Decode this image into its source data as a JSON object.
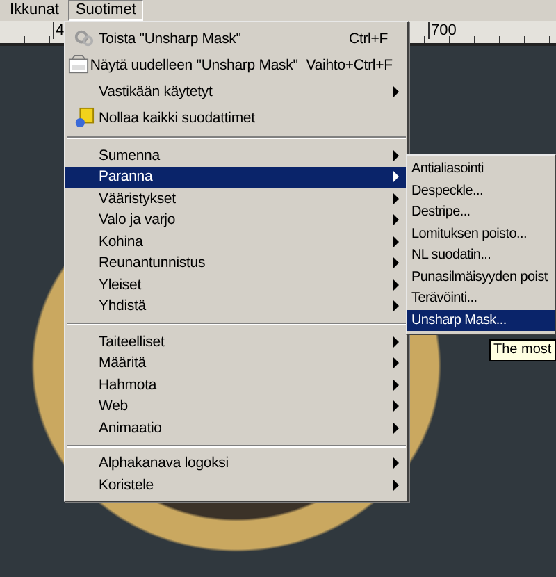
{
  "menubar": [
    {
      "label": "Ikkunat",
      "selected": false
    },
    {
      "label": "Suotimet",
      "selected": true
    }
  ],
  "ruler": {
    "labels": [
      "4",
      "700"
    ]
  },
  "menu": {
    "sections": [
      {
        "items": [
          {
            "label": "Toista \"Unsharp Mask\"",
            "shortcut": "Ctrl+F",
            "submenu": false,
            "selected": false
          },
          {
            "label": "Näytä uudelleen \"Unsharp Mask\"",
            "shortcut": "Vaihto+Ctrl+F",
            "submenu": false,
            "selected": false
          },
          {
            "label": "Vastikään käytetyt",
            "submenu": true,
            "selected": false
          },
          {
            "label": "Nollaa kaikki suodattimet",
            "submenu": false,
            "selected": false
          }
        ]
      },
      {
        "items": [
          {
            "label": "Sumenna",
            "submenu": true,
            "selected": false
          },
          {
            "label": "Paranna",
            "submenu": true,
            "selected": true
          },
          {
            "label": "Vääristykset",
            "submenu": true,
            "selected": false
          },
          {
            "label": "Valo ja varjo",
            "submenu": true,
            "selected": false
          },
          {
            "label": "Kohina",
            "submenu": true,
            "selected": false
          },
          {
            "label": "Reunantunnistus",
            "submenu": true,
            "selected": false
          },
          {
            "label": "Yleiset",
            "submenu": true,
            "selected": false
          },
          {
            "label": "Yhdistä",
            "submenu": true,
            "selected": false
          }
        ]
      },
      {
        "items": [
          {
            "label": "Taiteelliset",
            "submenu": true,
            "selected": false
          },
          {
            "label": "Määritä",
            "submenu": true,
            "selected": false
          },
          {
            "label": "Hahmota",
            "submenu": true,
            "selected": false
          },
          {
            "label": "Web",
            "submenu": true,
            "selected": false
          },
          {
            "label": "Animaatio",
            "submenu": true,
            "selected": false
          }
        ]
      },
      {
        "items": [
          {
            "label": "Alphakanava logoksi",
            "submenu": true,
            "selected": false
          },
          {
            "label": "Koristele",
            "submenu": true,
            "selected": false
          }
        ]
      }
    ]
  },
  "submenu": {
    "items": [
      {
        "label": "Antialiasointi",
        "selected": false
      },
      {
        "label": "Despeckle...",
        "selected": false
      },
      {
        "label": "Destripe...",
        "selected": false
      },
      {
        "label": "Lomituksen poisto...",
        "selected": false
      },
      {
        "label": "NL suodatin...",
        "selected": false
      },
      {
        "label": "Punasilmäisyyden poist",
        "selected": false
      },
      {
        "label": "Terävöinti...",
        "selected": false
      },
      {
        "label": "Unsharp Mask...",
        "selected": true
      }
    ]
  },
  "tooltip": "The most"
}
